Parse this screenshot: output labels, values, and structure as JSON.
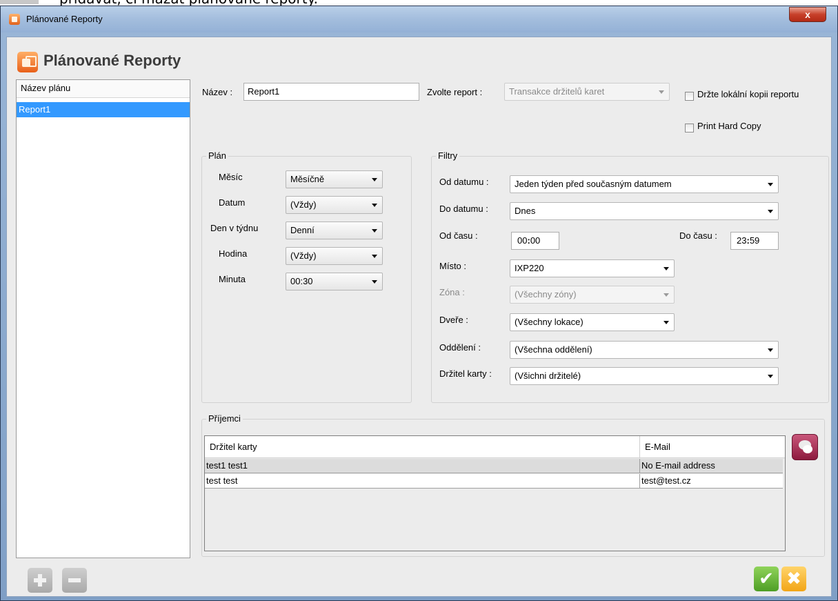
{
  "top_caption": "přidávat, či mazat plánované reporty.",
  "window": {
    "title": "Plánované Reporty",
    "close_label": "x"
  },
  "header": {
    "title": "Plánované Reporty"
  },
  "plan_list": {
    "header": "Název plánu",
    "items": [
      "Report1"
    ]
  },
  "name_field": {
    "label": "Název :",
    "value": "Report1"
  },
  "report_select": {
    "label": "Zvolte report :",
    "value": "Transakce držitelů karet"
  },
  "options": {
    "local_copy": "Držte lokální kopii reportu",
    "hard_copy": "Print Hard Copy"
  },
  "plan": {
    "title": "Plán",
    "rows": [
      {
        "label": "Měsíc",
        "value": "Měsíčně"
      },
      {
        "label": "Datum",
        "value": "(Vždy)"
      },
      {
        "label": "Den v týdnu",
        "value": "Denní"
      },
      {
        "label": "Hodina",
        "value": "(Vždy)"
      },
      {
        "label": "Minuta",
        "value": "00:30"
      }
    ]
  },
  "filters": {
    "title": "Filtry",
    "from_date": {
      "label": "Od datumu :",
      "value": "Jeden týden před současným datumem"
    },
    "to_date": {
      "label": "Do datumu :",
      "value": "Dnes"
    },
    "from_time": {
      "label": "Od času :",
      "hh": "00",
      "mm": "00"
    },
    "to_time": {
      "label": "Do času :",
      "hh": "23",
      "mm": "59"
    },
    "place": {
      "label": "Místo :",
      "value": "IXP220"
    },
    "zone": {
      "label": "Zóna :",
      "value": "(Všechny zóny)"
    },
    "doors": {
      "label": "Dveře :",
      "value": "(Všechny lokace)"
    },
    "department": {
      "label": "Oddělení :",
      "value": "(Všechna oddělení)"
    },
    "card_holder": {
      "label": "Držitel karty :",
      "value": "(Všichni držitelé)"
    }
  },
  "recipients": {
    "title": "Příjemci",
    "columns": [
      "Držitel karty",
      "E-Mail"
    ],
    "rows": [
      {
        "holder": "test1 test1",
        "email": "No E-mail address"
      },
      {
        "holder": "test test",
        "email": "test@test.cz"
      }
    ]
  },
  "colors": {
    "selection": "#3399ff",
    "ok": "#5fb02f",
    "cancel": "#f5b41f",
    "mail": "#a2264e"
  }
}
